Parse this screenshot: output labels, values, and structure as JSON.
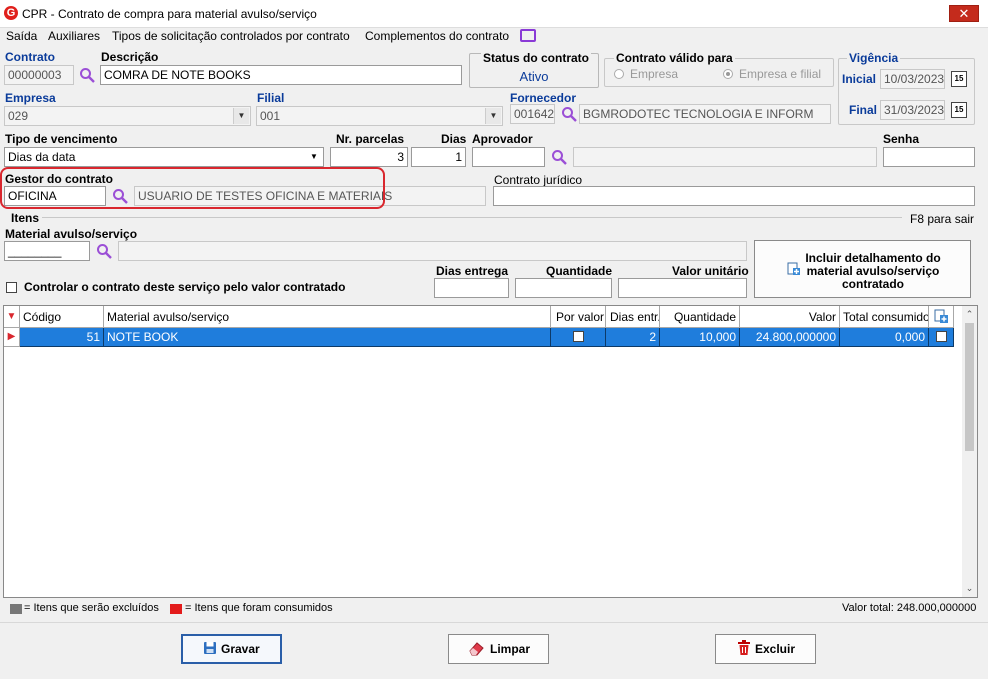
{
  "window": {
    "title": "CPR - Contrato de compra para material avulso/serviço",
    "close": "✕"
  },
  "menu": [
    "Saída",
    "Auxiliares",
    "Tipos de solicitação controlados por contrato",
    "Complementos do contrato"
  ],
  "contrato": {
    "label": "Contrato",
    "value": "00000003"
  },
  "descricao": {
    "label": "Descrição",
    "value": "COMRA DE NOTE BOOKS"
  },
  "status": {
    "label": "Status do contrato",
    "value": "Ativo"
  },
  "valido": {
    "label": "Contrato válido para",
    "opt1": "Empresa",
    "opt2": "Empresa e filial"
  },
  "vigencia": {
    "label": "Vigência",
    "inicial_label": "Inicial",
    "inicial": "10/03/2023",
    "final_label": "Final",
    "final": "31/03/2023",
    "cal_icon": "15"
  },
  "empresa": {
    "label": "Empresa",
    "value": "029"
  },
  "filial": {
    "label": "Filial",
    "value": "001"
  },
  "fornecedor": {
    "label": "Fornecedor",
    "code": "001642",
    "name": "BGMRODOTEC TECNOLOGIA E INFORM"
  },
  "tipo_venc": {
    "label": "Tipo de vencimento",
    "value": "Dias da data"
  },
  "parcelas": {
    "label": "Nr. parcelas",
    "value": "3"
  },
  "dias": {
    "label": "Dias",
    "value": "1"
  },
  "aprovador": {
    "label": "Aprovador",
    "value": ""
  },
  "senha": {
    "label": "Senha",
    "value": ""
  },
  "gestor": {
    "label": "Gestor do contrato",
    "code": "OFICINA",
    "name": "USUARIO DE TESTES OFICINA E MATERIAIS"
  },
  "juridico": {
    "label": "Contrato jurídico",
    "value": ""
  },
  "itens": {
    "label": "Itens",
    "hint": "F8 para sair"
  },
  "material": {
    "label": "Material avulso/serviço",
    "value": "________"
  },
  "controlar": {
    "label": "Controlar o contrato deste serviço pelo valor contratado"
  },
  "dias_entrega": {
    "label": "Dias entrega"
  },
  "quantidade": {
    "label": "Quantidade"
  },
  "valor_unit": {
    "label": "Valor unitário"
  },
  "incluir": {
    "line1": "Incluir detalhamento do",
    "line2": "material avulso/serviço",
    "line3": "contratado"
  },
  "grid": {
    "headers": {
      "codigo": "Código",
      "material": "Material avulso/serviço",
      "por_valor": "Por valor",
      "dias": "Dias entr.",
      "qtd": "Quantidade",
      "valor": "Valor",
      "total": "Total consumido"
    },
    "rows": [
      {
        "codigo": "51",
        "material": "NOTE BOOK",
        "dias": "2",
        "qtd": "10,000",
        "valor": "24.800,000000",
        "total": "0,000"
      }
    ]
  },
  "legend": {
    "excluidos": "= Itens que serão excluídos",
    "consumidos": "= Itens que foram consumidos",
    "total": "Valor total: 248.000,000000"
  },
  "buttons": {
    "gravar": "Gravar",
    "limpar": "Limpar",
    "excluir": "Excluir"
  },
  "colors": {
    "accent": "#1f7ddc",
    "highlight": "#d9272e",
    "label_blue": "#0a3b9a"
  }
}
